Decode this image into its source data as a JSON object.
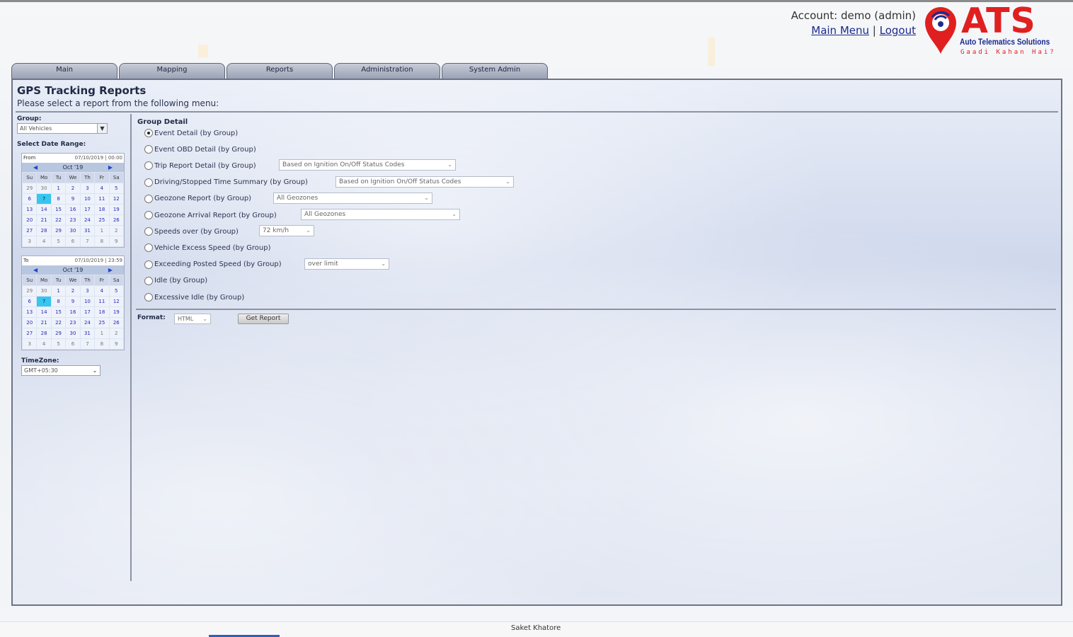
{
  "header": {
    "account_text": "Account: demo (admin)",
    "main_menu": "Main Menu",
    "separator": "|",
    "logout": "Logout"
  },
  "logo": {
    "title": "ATS",
    "subtitle": "Auto Telematics Solutions",
    "tagline": "Gaadi Kahan Hai?",
    "brand_red": "#e02020",
    "brand_blue": "#1c2a90"
  },
  "tabs": [
    {
      "label": "Main"
    },
    {
      "label": "Mapping"
    },
    {
      "label": "Reports"
    },
    {
      "label": "Administration"
    },
    {
      "label": "System Admin"
    }
  ],
  "page": {
    "title": "GPS Tracking Reports",
    "subtitle": "Please select a report from the following menu:"
  },
  "sidebar": {
    "group_label": "Group:",
    "group_value": "All Vehicles",
    "date_range_label": "Select Date Range:",
    "from": {
      "label": "From",
      "datetime": "07/10/2019 | 00:00",
      "month": "Oct '19",
      "weekdays": [
        "Su",
        "Mo",
        "Tu",
        "We",
        "Th",
        "Fr",
        "Sa"
      ],
      "days": [
        "29",
        "30",
        "1",
        "2",
        "3",
        "4",
        "5",
        "6",
        "7",
        "8",
        "9",
        "10",
        "11",
        "12",
        "13",
        "14",
        "15",
        "16",
        "17",
        "18",
        "19",
        "20",
        "21",
        "22",
        "23",
        "24",
        "25",
        "26",
        "27",
        "28",
        "29",
        "30",
        "31",
        "1",
        "2",
        "3",
        "4",
        "5",
        "6",
        "7",
        "8",
        "9"
      ],
      "selected": "7"
    },
    "to": {
      "label": "To",
      "datetime": "07/10/2019 | 23:59",
      "month": "Oct '19",
      "weekdays": [
        "Su",
        "Mo",
        "Tu",
        "We",
        "Th",
        "Fr",
        "Sa"
      ],
      "days": [
        "29",
        "30",
        "1",
        "2",
        "3",
        "4",
        "5",
        "6",
        "7",
        "8",
        "9",
        "10",
        "11",
        "12",
        "13",
        "14",
        "15",
        "16",
        "17",
        "18",
        "19",
        "20",
        "21",
        "22",
        "23",
        "24",
        "25",
        "26",
        "27",
        "28",
        "29",
        "30",
        "31",
        "1",
        "2",
        "3",
        "4",
        "5",
        "6",
        "7",
        "8",
        "9"
      ],
      "selected": "7"
    },
    "timezone_label": "TimeZone:",
    "timezone_value": "GMT+05:30"
  },
  "report": {
    "group_label": "Group Detail",
    "options": [
      {
        "label": "Event Detail (by Group)",
        "checked": true,
        "select": null
      },
      {
        "label": "Event OBD Detail (by Group)",
        "checked": false,
        "select": null
      },
      {
        "label": "Trip Report Detail (by Group)",
        "checked": false,
        "select": "Based on Ignition On/Off Status Codes"
      },
      {
        "label": "Driving/Stopped Time Summary (by Group)",
        "checked": false,
        "select": "Based on Ignition On/Off Status Codes"
      },
      {
        "label": "Geozone Report (by Group)",
        "checked": false,
        "select": "All Geozones"
      },
      {
        "label": "Geozone Arrival Report (by Group)",
        "checked": false,
        "select": "All Geozones"
      },
      {
        "label": "Speeds over (by Group)",
        "checked": false,
        "select": "72 km/h"
      },
      {
        "label": "Vehicle Excess Speed (by Group)",
        "checked": false,
        "select": null
      },
      {
        "label": "Exceeding Posted Speed (by Group)",
        "checked": false,
        "select": "over limit"
      },
      {
        "label": "Idle (by Group)",
        "checked": false,
        "select": null
      },
      {
        "label": "Excessive Idle (by Group)",
        "checked": false,
        "select": null
      }
    ],
    "format_label": "Format:",
    "format_value": "HTML",
    "get_report": "Get Report"
  },
  "footer": {
    "credit": "Saket Khatore"
  }
}
